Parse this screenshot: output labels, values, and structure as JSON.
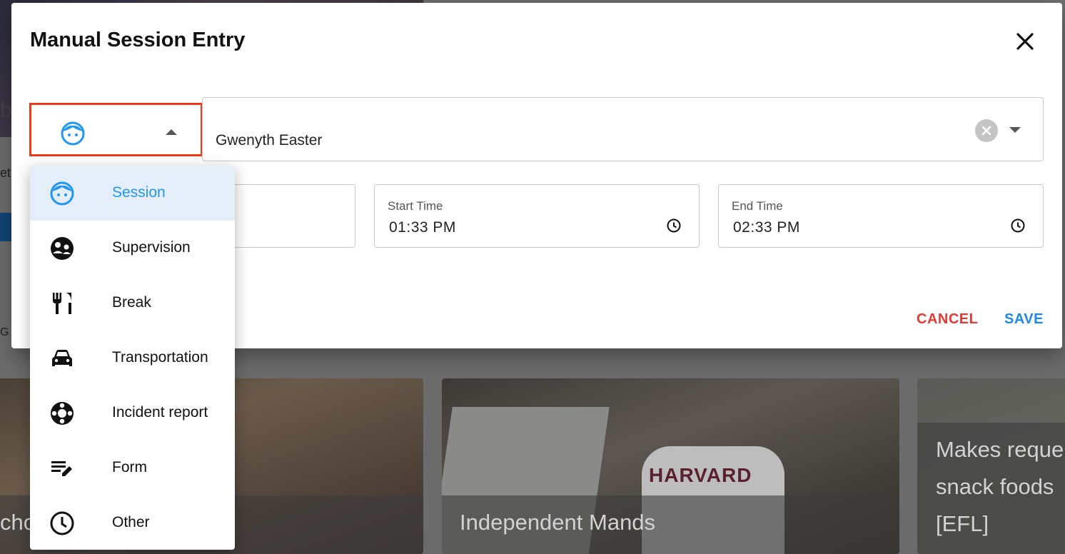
{
  "dialog": {
    "title": "Manual Session Entry",
    "client_value": "Gwenyth Easter",
    "start_time": {
      "label": "Start Time",
      "value": "01:33  PM"
    },
    "end_time": {
      "label": "End Time",
      "value": "02:33  PM"
    },
    "cancel_label": "CANCEL",
    "save_label": "SAVE"
  },
  "type_menu": {
    "selected": "Session",
    "items": [
      {
        "label": "Session",
        "icon": "face-icon"
      },
      {
        "label": "Supervision",
        "icon": "supervision-icon"
      },
      {
        "label": "Break",
        "icon": "restaurant-icon"
      },
      {
        "label": "Transportation",
        "icon": "car-icon"
      },
      {
        "label": "Incident report",
        "icon": "life-ring-icon"
      },
      {
        "label": "Form",
        "icon": "form-edit-icon"
      },
      {
        "label": "Other",
        "icon": "clock-icon"
      }
    ]
  },
  "background": {
    "frag_b": "b",
    "frag_et": "et",
    "frag_g": "G",
    "card1_caption": "cho",
    "card2_caption": "Independent Mands",
    "card2_shirt": "HARVARD",
    "card3_caption_lines": [
      "Makes reque",
      "snack foods",
      "[EFL]"
    ]
  },
  "colors": {
    "accent": "#2196f3",
    "highlight_border": "#f03a17",
    "cancel": "#e53935",
    "selected_bg": "#e3eef9"
  }
}
